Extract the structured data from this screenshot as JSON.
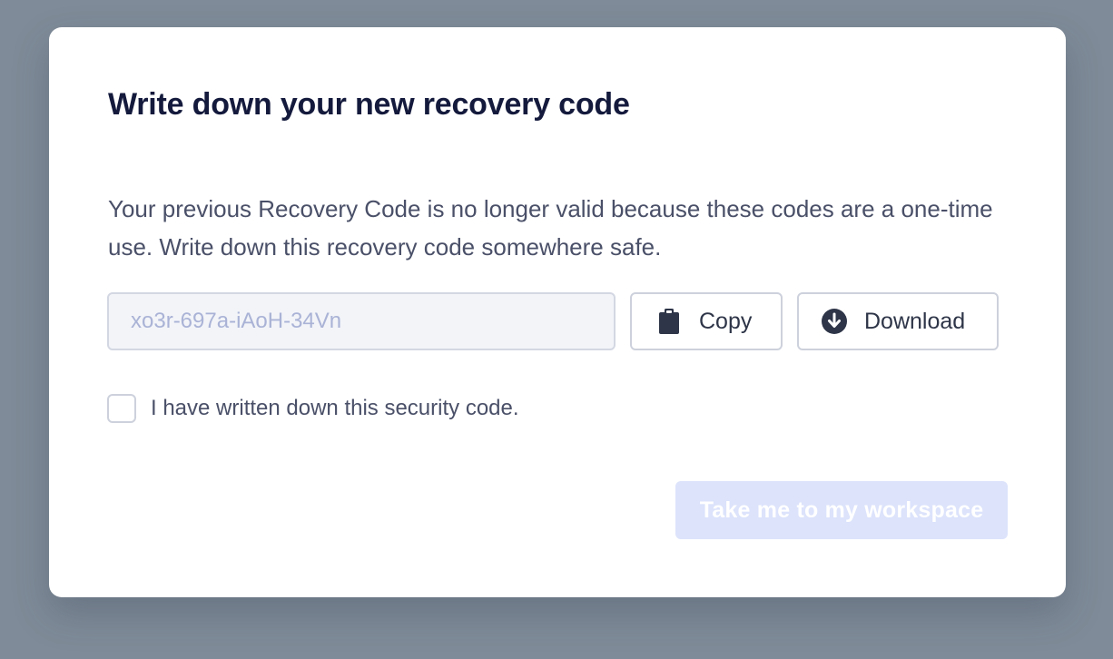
{
  "modal": {
    "title": "Write down your new recovery code",
    "description": "Your previous Recovery Code is no longer valid because these codes are a one-time use. Write down this recovery code somewhere safe.",
    "recovery_code": {
      "placeholder": "xo3r-697a-iAoH-34Vn",
      "value": ""
    },
    "copy_button": {
      "label": "Copy",
      "icon": "clipboard-icon"
    },
    "download_button": {
      "label": "Download",
      "icon": "download-circle-icon"
    },
    "confirm_checkbox": {
      "label": "I have written down this security code.",
      "checked": false
    },
    "primary_button": {
      "label": "Take me to my workspace",
      "disabled": true
    }
  },
  "colors": {
    "backdrop": "#7f8b98",
    "title": "#141a3c",
    "body_text": "#4a5068",
    "primary_disabled": "#dce3fb",
    "code_text": "#aab3d6"
  }
}
